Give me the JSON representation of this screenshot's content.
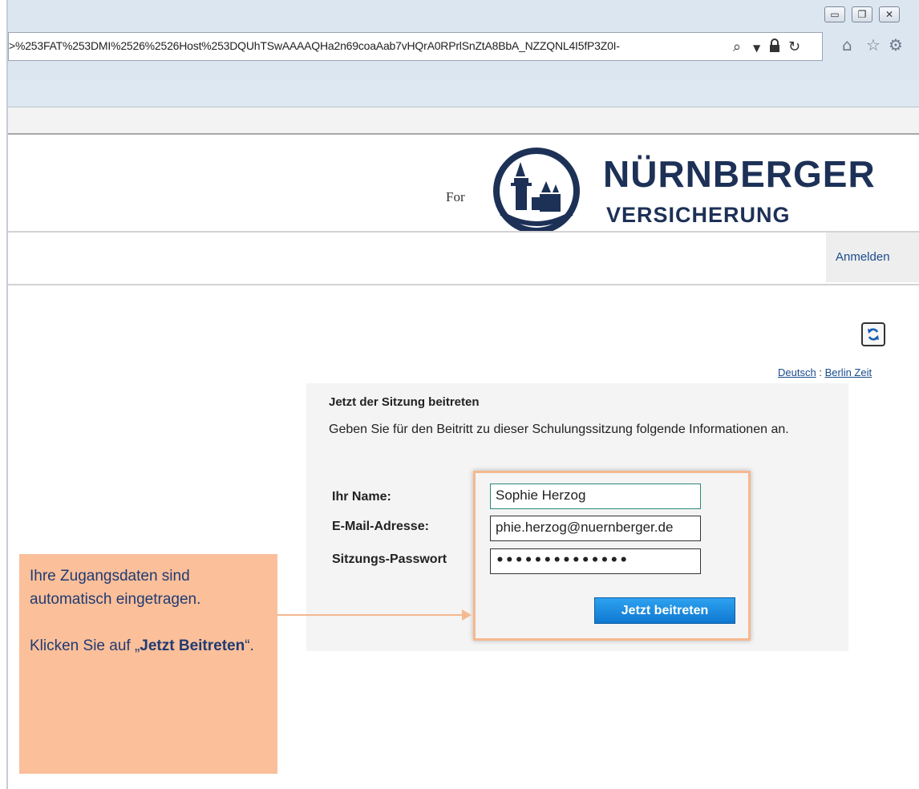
{
  "browser": {
    "address_url": ">%253FAT%253DMI%2526%2526Host%253DQUhTSwAAAAQHa2n69coaAab7vHQrA0RPrlSnZtA8BbA_NZZQNL4I5fP3Z0I-",
    "icons": [
      "minimize-icon",
      "restore-icon",
      "close-icon",
      "search-icon",
      "dropdown-icon",
      "lock-icon",
      "refresh-icon",
      "home-icon",
      "favorites-star-icon",
      "settings-gear-icon"
    ]
  },
  "header": {
    "for_text": "For",
    "brand_title": "NÜRNBERGER",
    "brand_subtitle": "VERSICHERUNG",
    "brand_color": "#1d3157"
  },
  "nav": {
    "login_label": "Anmelden"
  },
  "meta": {
    "language_link": "Deutsch",
    "separator": ":",
    "timezone_link": "Berlin Zeit"
  },
  "join_form": {
    "title": "Jetzt der Sitzung beitreten",
    "description": "Geben Sie für den Beitritt zu dieser Schulungssitzung folgende Informationen an.",
    "name_label": "Ihr Name:",
    "name_value": "Sophie Herzog",
    "email_label": "E-Mail-Adresse:",
    "email_value": "phie.herzog@nuernberger.de",
    "password_label": "Sitzungs-Passwort",
    "password_value": "••••••••••••••",
    "join_button": "Jetzt beitreten",
    "button_color": "#1b8ce3"
  },
  "callout": {
    "line1": "Ihre Zugangsdaten sind automatisch eingetragen.",
    "line2_prefix": "Klicken Sie auf „",
    "line2_bold": "Jetzt Beitreten",
    "line2_suffix": "“.",
    "background_color": "#fbbf9a",
    "text_color": "#1f3b71"
  }
}
